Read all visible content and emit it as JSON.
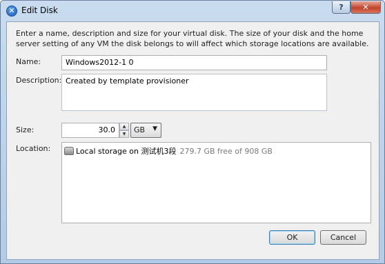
{
  "window": {
    "title": "Edit Disk",
    "help_symbol": "?",
    "close_symbol": "✕"
  },
  "instructions": "Enter a name, description and size for your virtual disk. The size of your disk and the home server setting of any VM the disk belongs to will affect which storage locations are available.",
  "form": {
    "name_label": "Name:",
    "name_value": "Windows2012-1 0",
    "description_label": "Description:",
    "description_value": "Created by template provisioner",
    "size_label": "Size:",
    "size_value": "30.0",
    "size_unit": "GB",
    "location_label": "Location:"
  },
  "locations": [
    {
      "icon": "disk-icon",
      "name": "Local storage on 测试机3段",
      "free": "279.7 GB free of 908 GB"
    }
  ],
  "buttons": {
    "ok": "OK",
    "cancel": "Cancel"
  },
  "colors": {
    "title_gradient": "#b3cbe6",
    "client_bg": "#f0f0f0",
    "close_red": "#c0442b"
  }
}
